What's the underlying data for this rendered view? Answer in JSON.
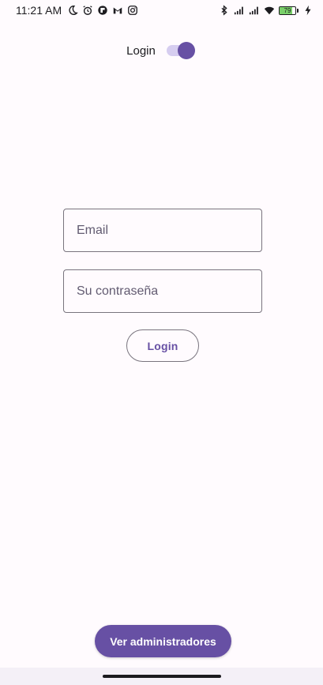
{
  "status_bar": {
    "time": "11:21 AM",
    "left_icons": [
      "moon-icon",
      "alarm-icon",
      "app-notification-icon",
      "gmail-icon",
      "instagram-icon"
    ],
    "right_icons": [
      "bluetooth-icon",
      "signal-icon",
      "signal-icon",
      "wifi-icon"
    ],
    "battery_level": "79",
    "battery_color": "#7ad06a",
    "charging_icon": "bolt-icon"
  },
  "header": {
    "toggle_label": "Login",
    "toggle_on": true
  },
  "form": {
    "email_placeholder": "Email",
    "password_placeholder": "Su contraseña",
    "login_label": "Login"
  },
  "footer": {
    "admins_label": "Ver administradores"
  },
  "colors": {
    "primary": "#6750a4",
    "background": "#fffbfe",
    "outline": "#79747e"
  }
}
